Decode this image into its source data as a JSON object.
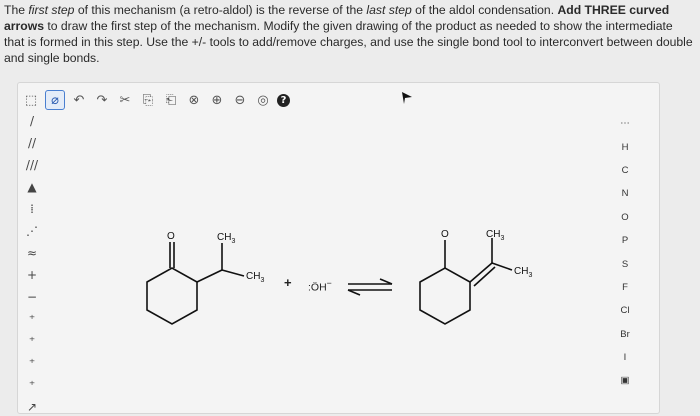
{
  "question": {
    "part1": "The ",
    "part2_italic": "first step",
    "part3": " of this mechanism (a retro-aldol) is the reverse of the ",
    "part4_italic": "last step",
    "part5": " of the aldol condensation. ",
    "part6_bold": "Add THREE curved arrows",
    "part7": " to draw the first step of the mechanism. Modify the given drawing of the product as needed to show the intermediate that is formed in this step. Use the +/- tools to add/remove charges, and use the single bond tool to interconvert between double and single bonds."
  },
  "toolbar_top": [
    {
      "name": "select-tool",
      "glyph": "⬚"
    },
    {
      "name": "eraser-tool",
      "glyph": "⌀",
      "active": true
    },
    {
      "name": "undo-button",
      "glyph": "↶"
    },
    {
      "name": "redo-button",
      "glyph": "↷"
    },
    {
      "name": "cut-button",
      "glyph": "✂"
    },
    {
      "name": "copy-button",
      "glyph": "⎘"
    },
    {
      "name": "paste-button",
      "glyph": "⎗"
    },
    {
      "name": "clear-button",
      "glyph": "⊗"
    },
    {
      "name": "zoom-in-button",
      "glyph": "⊕"
    },
    {
      "name": "zoom-out-button",
      "glyph": "⊖"
    },
    {
      "name": "zoom-fit-button",
      "glyph": "◎"
    },
    {
      "name": "help-button",
      "glyph": "?"
    }
  ],
  "toolbar_left": [
    {
      "name": "single-bond-tool",
      "glyph": "/"
    },
    {
      "name": "double-bond-tool",
      "glyph": "//"
    },
    {
      "name": "triple-bond-tool",
      "glyph": "///"
    },
    {
      "name": "wedge-bond-tool",
      "glyph": "▲"
    },
    {
      "name": "hash-bond-tool",
      "glyph": "⁞"
    },
    {
      "name": "dashed-bond-tool",
      "glyph": "⋰"
    },
    {
      "name": "chain-tool",
      "glyph": "≈"
    },
    {
      "name": "positive-charge-tool",
      "glyph": "+"
    },
    {
      "name": "negative-charge-tool",
      "glyph": "−"
    },
    {
      "name": "radical-tool",
      "glyph": "⁺"
    },
    {
      "name": "lone-pair-tool",
      "glyph": "⁺"
    },
    {
      "name": "electron-tool",
      "glyph": "⁺"
    },
    {
      "name": "arrow-tool",
      "glyph": "⁺"
    },
    {
      "name": "curved-arrow-tool",
      "glyph": "↗"
    }
  ],
  "elements": [
    "⋯",
    "H",
    "C",
    "N",
    "O",
    "P",
    "S",
    "F",
    "Cl",
    "Br",
    "I",
    "▣"
  ],
  "molecule_labels": {
    "o1": "O",
    "ch3_top1": "CH",
    "ch3_side1": "CH",
    "plus": "+",
    "oh": ":ÖH",
    "oh_charge": "−",
    "o2": "O",
    "ch3_top2": "CH",
    "ch3_side2": "CH",
    "sub3": "3"
  },
  "colors": {
    "accent": "#4a7fd0",
    "background": "#ececec",
    "canvas": "#f4f4f4"
  }
}
